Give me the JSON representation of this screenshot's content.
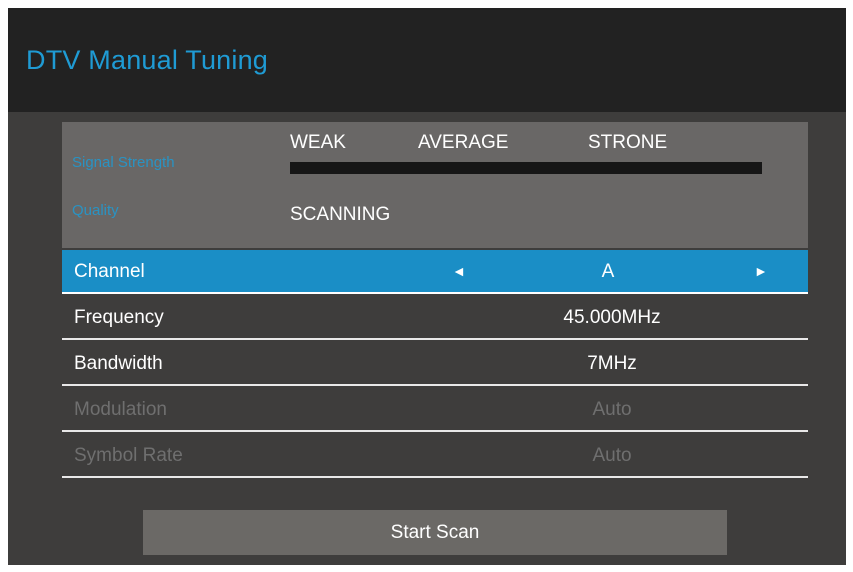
{
  "header": {
    "title": "DTV Manual Tuning"
  },
  "signal": {
    "strength_label": "Signal Strength",
    "quality_label": "Quality",
    "levels": [
      "WEAK",
      "AVERAGE",
      "STRONE"
    ],
    "strength_fraction": 0,
    "quality_value": "SCANNING"
  },
  "settings": {
    "channel": {
      "label": "Channel",
      "value": "A",
      "left_arrow": "◄",
      "right_arrow": "►"
    },
    "frequency": {
      "label": "Frequency",
      "value": "45.000MHz"
    },
    "bandwidth": {
      "label": "Bandwidth",
      "value": "7MHz"
    },
    "modulation": {
      "label": "Modulation",
      "value": "Auto"
    },
    "symbol_rate": {
      "label": "Symbol Rate",
      "value": "Auto"
    }
  },
  "scan_button": {
    "label": "Start Scan"
  },
  "colors": {
    "accent": "#1f9bd4",
    "selected_row": "#1a8ec6",
    "background": "#3e3d3c",
    "header": "#222222"
  }
}
